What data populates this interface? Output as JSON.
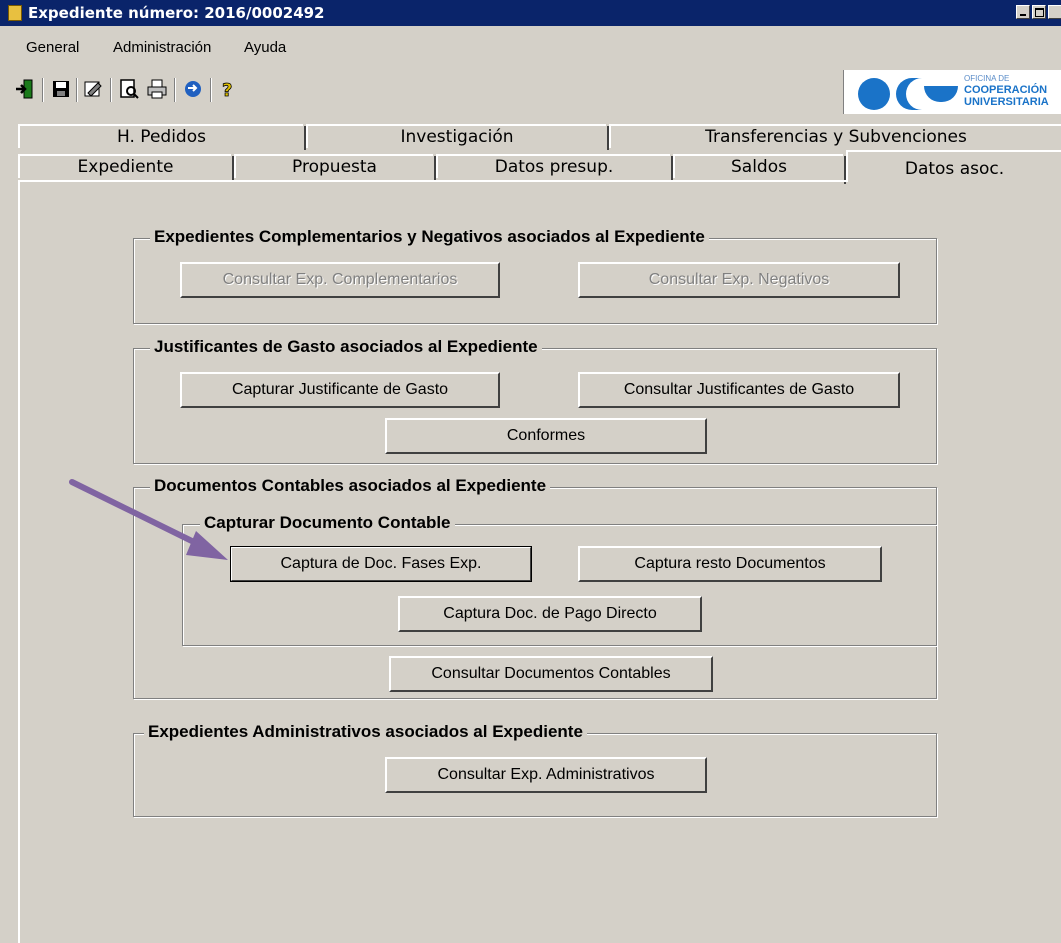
{
  "window": {
    "title": "Expediente número: 2016/0002492"
  },
  "menu": {
    "items": [
      "General",
      "Administración",
      "Ayuda"
    ]
  },
  "toolbar": {
    "icons": [
      "exit-icon",
      "save-icon",
      "edit-icon",
      "preview-icon",
      "print-icon",
      "refresh-icon",
      "help-icon"
    ]
  },
  "logo": {
    "line1": "OFICINA DE",
    "line2": "COOPERACIÓN",
    "line3": "UNIVERSITARIA",
    "color": "#1a73c8"
  },
  "tabs": {
    "row1": [
      "H. Pedidos",
      "Investigación",
      "Transferencias y Subvenciones"
    ],
    "row2": [
      "Expediente",
      "Propuesta",
      "Datos presup.",
      "Saldos",
      "Datos asoc."
    ],
    "active": "Datos asoc."
  },
  "groups": {
    "complementarios": {
      "title": "Expedientes Complementarios y Negativos asociados al Expediente",
      "btn_complementarios": "Consultar Exp. Complementarios",
      "btn_negativos": "Consultar Exp. Negativos"
    },
    "justificantes": {
      "title": "Justificantes de Gasto asociados al Expediente",
      "btn_capturar": "Capturar Justificante de Gasto",
      "btn_consultar": "Consultar Justificantes de Gasto",
      "btn_conformes": "Conformes"
    },
    "contables": {
      "title": "Documentos Contables asociados al Expediente",
      "sub_title": "Capturar Documento Contable",
      "btn_fases": "Captura de Doc. Fases Exp.",
      "btn_resto": "Captura resto Documentos",
      "btn_pago": "Captura Doc. de Pago Directo",
      "btn_consultar": "Consultar Documentos Contables"
    },
    "administrativos": {
      "title": "Expedientes Administrativos asociados al Expediente",
      "btn_consultar": "Consultar Exp. Administrativos"
    }
  },
  "annotation": {
    "arrow_color": "#8064a2"
  }
}
